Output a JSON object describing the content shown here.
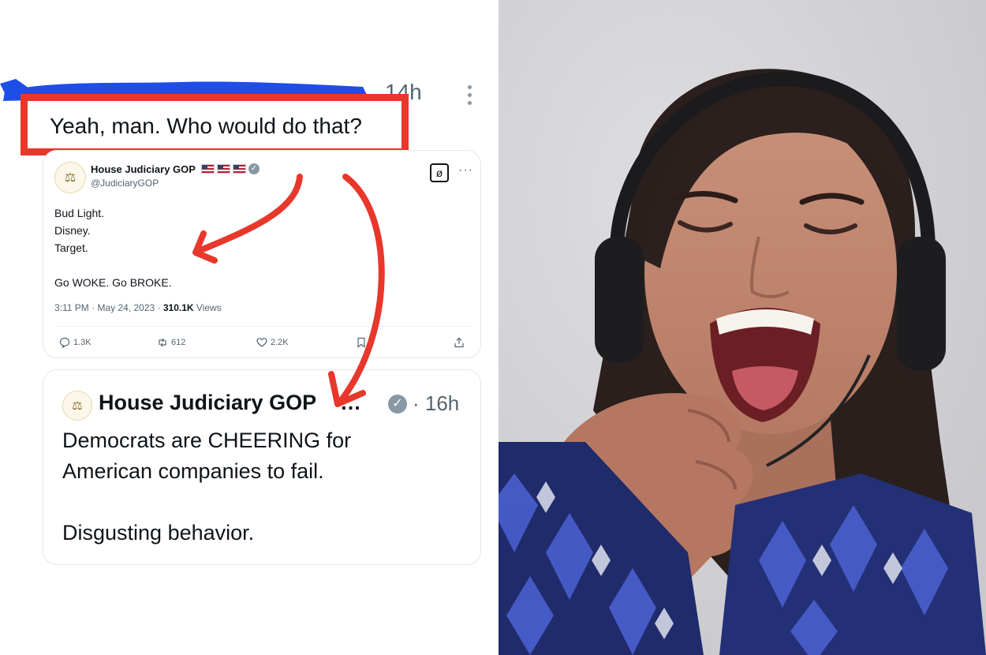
{
  "reply": {
    "time": "14h",
    "text": "Yeah, man. Who would do that?"
  },
  "quoted_tweet": {
    "name": "House Judiciary GOP",
    "handle": "@JudiciaryGOP",
    "body": "Bud Light.\nDisney.\nTarget.\n\nGo WOKE. Go BROKE.",
    "timestamp": "3:11 PM · May 24, 2023 · ",
    "views_count": "310.1K",
    "views_label": " Views",
    "replies": "1.3K",
    "retweets": "612",
    "likes": "2.2K",
    "icons": [
      "grok-icon",
      "more-icon",
      "reply-icon",
      "retweet-icon",
      "like-icon",
      "bookmark-icon",
      "share-icon",
      "verified-icon",
      "scales-icon"
    ]
  },
  "original_tweet": {
    "name": "House Judiciary GOP",
    "ellipsis": "…",
    "time": "· 16h",
    "body": "Democrats are CHEERING for\nAmerican companies to fail.\n\nDisgusting behavior."
  },
  "colors": {
    "highlight": "#e8372b",
    "redaction": "#1d4ee8",
    "secondary_text": "#536471",
    "photo_background": "#d3d2d6"
  }
}
